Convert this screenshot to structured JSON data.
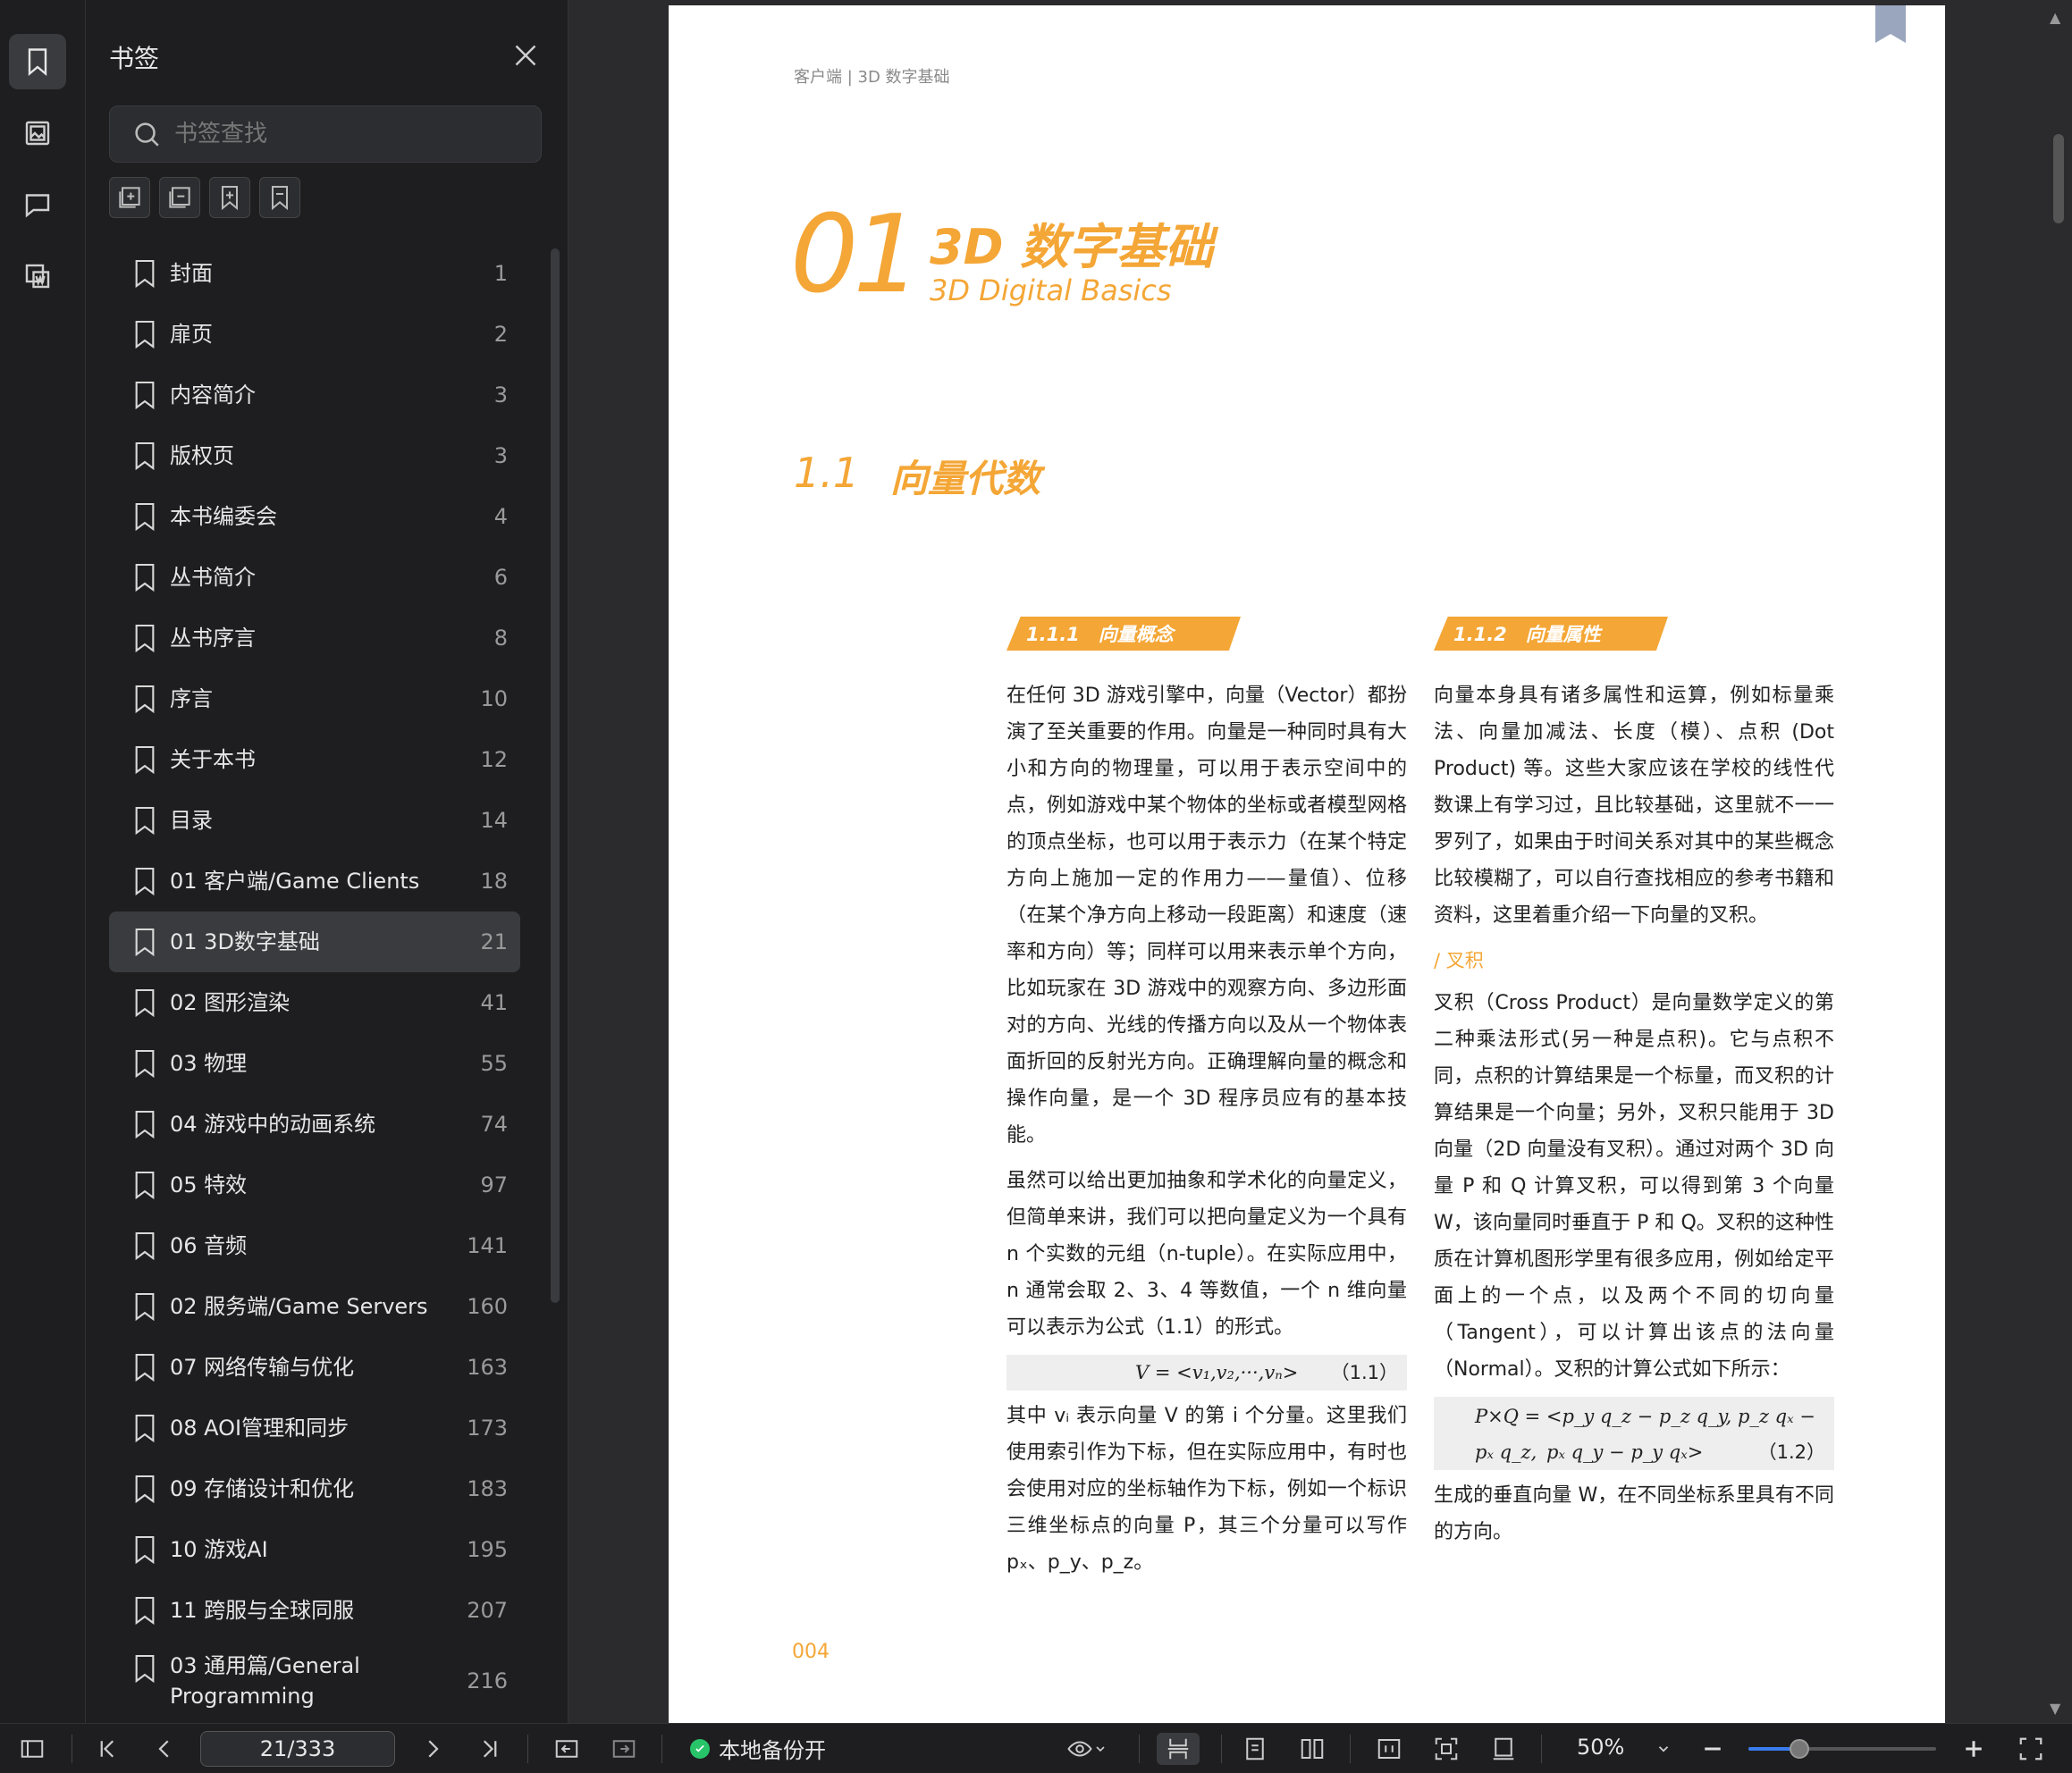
{
  "rail": {
    "items": [
      {
        "name": "bookmark",
        "active": true
      },
      {
        "name": "thumbnail",
        "active": false
      },
      {
        "name": "comment",
        "active": false
      },
      {
        "name": "ocr",
        "active": false
      }
    ]
  },
  "panel": {
    "title": "书签",
    "search_placeholder": "书签查找",
    "bookmarks": [
      {
        "label": "封面",
        "page": "1"
      },
      {
        "label": "扉页",
        "page": "2"
      },
      {
        "label": "内容简介",
        "page": "3"
      },
      {
        "label": "版权页",
        "page": "3"
      },
      {
        "label": "本书编委会",
        "page": "4"
      },
      {
        "label": "丛书简介",
        "page": "6"
      },
      {
        "label": "丛书序言",
        "page": "8"
      },
      {
        "label": "序言",
        "page": "10"
      },
      {
        "label": "关于本书",
        "page": "12"
      },
      {
        "label": "目录",
        "page": "14"
      },
      {
        "label": "01 客户端/Game Clients",
        "page": "18"
      },
      {
        "label": "01 3D数字基础",
        "page": "21",
        "selected": true
      },
      {
        "label": "02 图形渲染",
        "page": "41"
      },
      {
        "label": "03 物理",
        "page": "55"
      },
      {
        "label": "04 游戏中的动画系统",
        "page": "74"
      },
      {
        "label": "05 特效",
        "page": "97"
      },
      {
        "label": "06 音频",
        "page": "141"
      },
      {
        "label": "02 服务端/Game Servers",
        "page": "160"
      },
      {
        "label": "07 网络传输与优化",
        "page": "163"
      },
      {
        "label": "08 AOI管理和同步",
        "page": "173"
      },
      {
        "label": "09 存储设计和优化",
        "page": "183"
      },
      {
        "label": "10 游戏AI",
        "page": "195"
      },
      {
        "label": "11 跨服与全球同服",
        "page": "207"
      },
      {
        "label": "03 通用篇/General Programming",
        "page": "216",
        "tall": true
      }
    ]
  },
  "document": {
    "running_head": "客户端 | 3D 数字基础",
    "chapter_number": "01",
    "chapter_title_cn": "3D 数字基础",
    "chapter_title_en": "3D Digital Basics",
    "section_number": "1.1",
    "section_title": "向量代数",
    "sub1_title": "1.1.1　向量概念",
    "sub2_title": "1.1.2　向量属性",
    "left_p1": "在任何 3D 游戏引擎中，向量（Vector）都扮演了至关重要的作用。向量是一种同时具有大小和方向的物理量，可以用于表示空间中的点，例如游戏中某个物体的坐标或者模型网格的顶点坐标，也可以用于表示力（在某个特定方向上施加一定的作用力——量值）、位移（在某个净方向上移动一段距离）和速度（速率和方向）等；同样可以用来表示单个方向，比如玩家在 3D 游戏中的观察方向、多边形面对的方向、光线的传播方向以及从一个物体表面折回的反射光方向。正确理解向量的概念和操作向量，是一个 3D 程序员应有的基本技能。",
    "left_p2": "虽然可以给出更加抽象和学术化的向量定义，但简单来讲，我们可以把向量定义为一个具有 n 个实数的元组（n-tuple）。在实际应用中，n 通常会取 2、3、4 等数值，一个 n 维向量可以表示为公式（1.1）的形式。",
    "formula1": "V = <v₁,v₂,···,vₙ>",
    "formula1_num": "（1.1）",
    "left_p3": "其中 vᵢ 表示向量 V 的第 i 个分量。这里我们使用索引作为下标，但在实际应用中，有时也会使用对应的坐标轴作为下标，例如一个标识三维坐标点的向量 P，其三个分量可以写作 pₓ、p_y、p_z。",
    "right_p1": "向量本身具有诸多属性和运算，例如标量乘法、向量加减法、长度（模）、点积 (Dot Product) 等。这些大家应该在学校的线性代数课上有学习过，且比较基础，这里就不一一罗列了，如果由于时间关系对其中的某些概念比较模糊了，可以自行查找相应的参考书籍和资料，这里着重介绍一下向量的叉积。",
    "right_subtopic": "/ 叉积",
    "right_p2": "叉积（Cross Product）是向量数学定义的第二种乘法形式(另一种是点积)。它与点积不同，点积的计算结果是一个标量，而叉积的计算结果是一个向量；另外，叉积只能用于 3D 向量（2D 向量没有叉积）。通过对两个 3D 向量 P 和 Q 计算叉积，可以得到第 3 个向量 W，该向量同时垂直于 P 和 Q。叉积的这种性质在计算机图形学里有很多应用，例如给定平面上的一个点，以及两个不同的切向量（Tangent），可以计算出该点的法向量（Normal）。叉积的计算公式如下所示：",
    "formula2_l1": "P×Q = <p_y q_z − p_z q_y,  p_z qₓ − pₓ q_z,",
    "formula2_l2": "pₓ q_y − p_y qₓ>",
    "formula2_num": "（1.2）",
    "right_p3": "生成的垂直向量 W，在不同坐标系里具有不同的方向。",
    "page_number": "004"
  },
  "bottom_bar": {
    "page_indicator": "21/333",
    "backup_label": "本地备份开",
    "zoom": "50%",
    "zoom_fraction": 0.27
  },
  "colors": {
    "accent": "#f4a636",
    "backup_dot": "#28c46a",
    "slider": "#3a7cf0"
  }
}
